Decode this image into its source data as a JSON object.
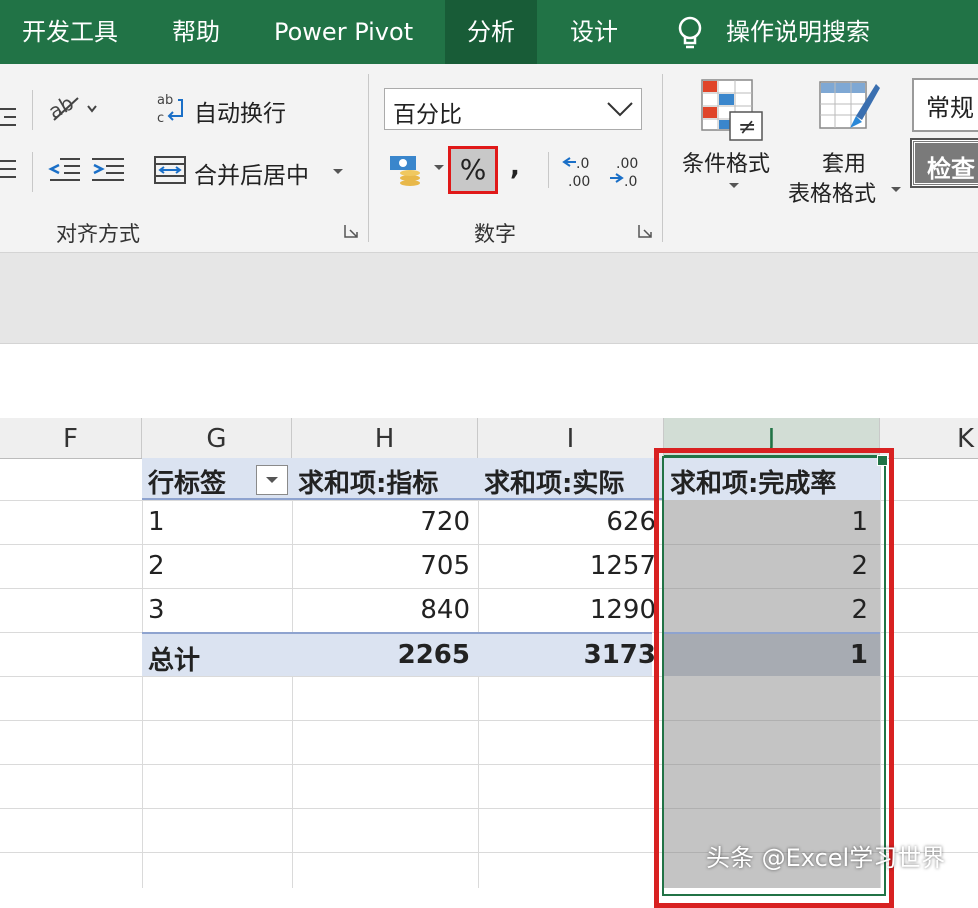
{
  "tabs": {
    "developer": "开发工具",
    "help": "帮助",
    "power_pivot": "Power Pivot",
    "analyze": "分析",
    "design": "设计",
    "tell_me": "操作说明搜索"
  },
  "ribbon": {
    "alignment": {
      "wrap_text": "自动换行",
      "merge_center": "合并后居中",
      "group_label": "对齐方式"
    },
    "number": {
      "format_value": "百分比",
      "percent_symbol": "%",
      "comma_symbol": ",",
      "increase_decimal": ".0",
      "increase_decimal_2": ".00",
      "decrease_decimal": ".00",
      "decrease_decimal_2": ".0",
      "group_label": "数字"
    },
    "styles": {
      "conditional_format": "条件格式",
      "table_format_1": "套用",
      "table_format_2": "表格格式",
      "normal_style": "常规",
      "check_style": "检查"
    }
  },
  "columns": [
    "F",
    "G",
    "H",
    "I",
    "J",
    "K"
  ],
  "pivot": {
    "headers": [
      "行标签",
      "求和项:指标",
      "求和项:实际",
      "求和项:完成率"
    ],
    "rows": [
      {
        "label": "1",
        "target": "720",
        "actual": "626",
        "rate": "1"
      },
      {
        "label": "2",
        "target": "705",
        "actual": "1257",
        "rate": "2"
      },
      {
        "label": "3",
        "target": "840",
        "actual": "1290",
        "rate": "2"
      }
    ],
    "total": {
      "label": "总计",
      "target": "2265",
      "actual": "3173",
      "rate": "1"
    }
  },
  "watermark": "头条 @Excel学习世界",
  "colors": {
    "excel_green": "#217346",
    "highlight_red": "#e01818",
    "pivot_header_blue": "#dbe3f1"
  }
}
